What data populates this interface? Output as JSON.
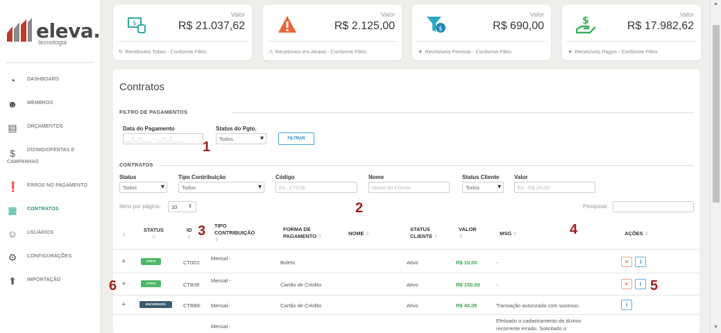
{
  "brand": {
    "name": "eleva.",
    "sub": "tecnologia"
  },
  "sidebar": {
    "items": [
      {
        "label": "DASHBOARD",
        "icon": "dashboard-icon"
      },
      {
        "label": "MEMBROS",
        "icon": "members-icon"
      },
      {
        "label": "ORÇAMENTOS",
        "icon": "budget-icon"
      },
      {
        "label": "DÍZIMO/OFERTAS E",
        "label2": "CAMPANHAS",
        "icon": "donation-icon"
      },
      {
        "label": "ERROS NO PAGAMENTO",
        "icon": "error-icon"
      },
      {
        "label": "CONTRATOS",
        "icon": "contract-icon"
      },
      {
        "label": "USUÁRIOS",
        "icon": "users-icon"
      },
      {
        "label": "CONFIGURAÇÕES",
        "icon": "gear-icon"
      },
      {
        "label": "IMPORTAÇÃO",
        "icon": "upload-icon"
      }
    ]
  },
  "cards": [
    {
      "caption": "Valor",
      "value": "R$ 21.037,62",
      "footer": "Recebíveis Totais - Conforme Filtro",
      "icon": "money-icon"
    },
    {
      "caption": "Valor",
      "value": "R$ 2.125,00",
      "footer": "Recebíveis em Atraso - Conforme Filtro",
      "icon": "warning-icon"
    },
    {
      "caption": "Valor",
      "value": "R$ 690,00",
      "footer": "Recebíveis Previsto - Conforme Filtro",
      "icon": "funnel-money-icon"
    },
    {
      "caption": "Valor",
      "value": "R$ 17.982,62",
      "footer": "Recebíveis Pagos - Conforme Filtro",
      "icon": "hand-money-icon"
    }
  ],
  "page": {
    "title": "Contratos"
  },
  "payment_filter": {
    "section": "FILTRO DE PAGAMENTOS",
    "date_label": "Data do Pagamento",
    "date_value": "__/__/____ - __/__/____",
    "status_label": "Status do Pgto.",
    "status_value": "Todos",
    "filter_button": "FILTRAR"
  },
  "contracts_filter": {
    "section": "CONTRATOS",
    "status_label": "Status",
    "status_value": "Todos",
    "tipo_label": "Tipo Contribuição",
    "tipo_value": "Todos",
    "codigo_label": "Código",
    "codigo_placeholder": "Ex.: CT01E",
    "nome_label": "Nome",
    "nome_placeholder": "Nome do Cliente",
    "status_cliente_label": "Status Cliente",
    "status_cliente_value": "Todos",
    "valor_label": "Valor",
    "valor_placeholder": "Ex.: R$ 20,00"
  },
  "table_controls": {
    "items_per_page_label": "Itens por página:",
    "items_per_page_value": "10",
    "search_label": "Pesquisar"
  },
  "table": {
    "headers": {
      "status": "STATUS",
      "id": "ID",
      "tipo1": "TIPO",
      "tipo2": "CONTRIBUIÇÃO",
      "forma1": "FORMA DE",
      "forma2": "PAGAMENTO",
      "nome": "NOME",
      "status_cliente1": "STATUS",
      "status_cliente2": "CLIENTE",
      "valor": "VALOR",
      "msg": "MSG",
      "acoes": "AÇÕES"
    },
    "rows": [
      {
        "status": "ATIVO",
        "status_color": "#4cb86a",
        "id": "CT0D2",
        "tipo": "Mensal -",
        "forma": "Boleto",
        "status_cliente": "Ativo",
        "valor": "R$ 10,00",
        "msg": "-"
      },
      {
        "status": "ATIVO",
        "status_color": "#4cb86a",
        "id": "CTB39",
        "tipo": "Mensal -",
        "forma": "Cartão de Crédito",
        "status_cliente": "Ativo",
        "valor": "R$ 150,00",
        "msg": "-"
      },
      {
        "status": "ENCERRADO",
        "status_color": "#3e5a6e",
        "id": "CTBBE",
        "tipo": "Mensal -",
        "forma": "Cartão de Crédito",
        "status_cliente": "Ativo",
        "valor": "R$ 40,05",
        "msg": "Transação autorizada com sucesso."
      },
      {
        "tipo": "Mensal -",
        "msg1": "Efetuado o cadastramento do dízimo",
        "msg2": "recorrente errado. Solicitado o"
      }
    ]
  },
  "annotations": [
    "1",
    "2",
    "3",
    "4",
    "5",
    "6"
  ],
  "colors": {
    "accent": "#2aa98d",
    "annotation": "#a01d1d",
    "green_value": "#3aa84a"
  }
}
